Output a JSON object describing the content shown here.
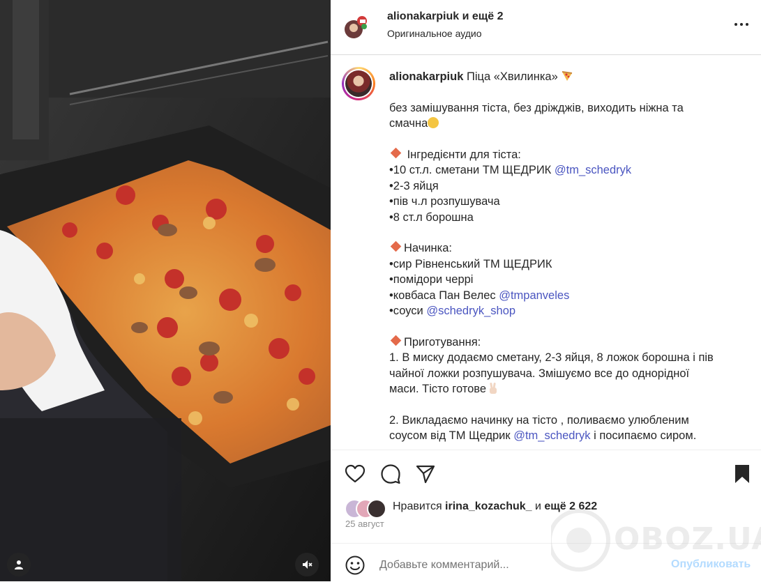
{
  "post": {
    "username": "alionakarpiuk",
    "coauthors": "и ещё 2",
    "audio": "Оригинальное аудио"
  },
  "caption": {
    "username": "alionakarpiuk",
    "title": "Піца «Хвилинка»",
    "intro_1": "без замішування тіста, без дріжджів, виходить ніжна та",
    "intro_2": "смачна",
    "dough_header": "Інгредієнти для тіста:",
    "dough_1_text": "•10 ст.л. сметани ТМ ЩЕДРИК ",
    "dough_1_link": "@tm_schedryk",
    "dough_2": "•2-3 яйця",
    "dough_3": "•пів ч.л розпушувача",
    "dough_4": "•8 ст.л борошна",
    "filling_header": "Начинка:",
    "filling_1": "•сир Рівненський ТМ ЩЕДРИК",
    "filling_2": "•помідори черрі",
    "filling_3_text": "•ковбаса Пан Велес ",
    "filling_3_link": "@tmpanveles",
    "filling_4_text": "•соуси ",
    "filling_4_link": "@schedryk_shop",
    "prep_header": "Приготування:",
    "prep_1a": "1. В миску додаємо сметану, 2-3 яйця, 8 ложок борошна і пів",
    "prep_1b": "чайної ложки розпушувача. Змішуємо все до однорідної",
    "prep_1c": "маси. Тісто готове",
    "prep_2a": "2. Викладаємо начинку на тісто , поливаємо улюбленим",
    "prep_2b_text": "соусом від ТМ Щедрик ",
    "prep_2b_link": "@tm_schedryk",
    "prep_2b_tail": " і посипаємо сиром."
  },
  "likes": {
    "prefix": "Нравится ",
    "user": "irina_kozachuk_",
    "suffix": " и ",
    "count": "ещё 2 622"
  },
  "date": "25 август",
  "comment": {
    "placeholder": "Добавьте комментарий...",
    "post_label": "Опубликовать"
  },
  "watermark": "OBOZ.UA",
  "icons": {
    "more": "more-horizontal-icon",
    "like": "heart-icon",
    "comment": "comment-bubble-icon",
    "share": "paper-plane-icon",
    "save": "bookmark-icon",
    "emoji": "smiley-icon",
    "user": "user-tag-icon",
    "mute": "speaker-muted-icon"
  },
  "colors": {
    "link": "#4a55c0",
    "post_button": "#b3dbff",
    "diamond": "#e46a4a"
  }
}
